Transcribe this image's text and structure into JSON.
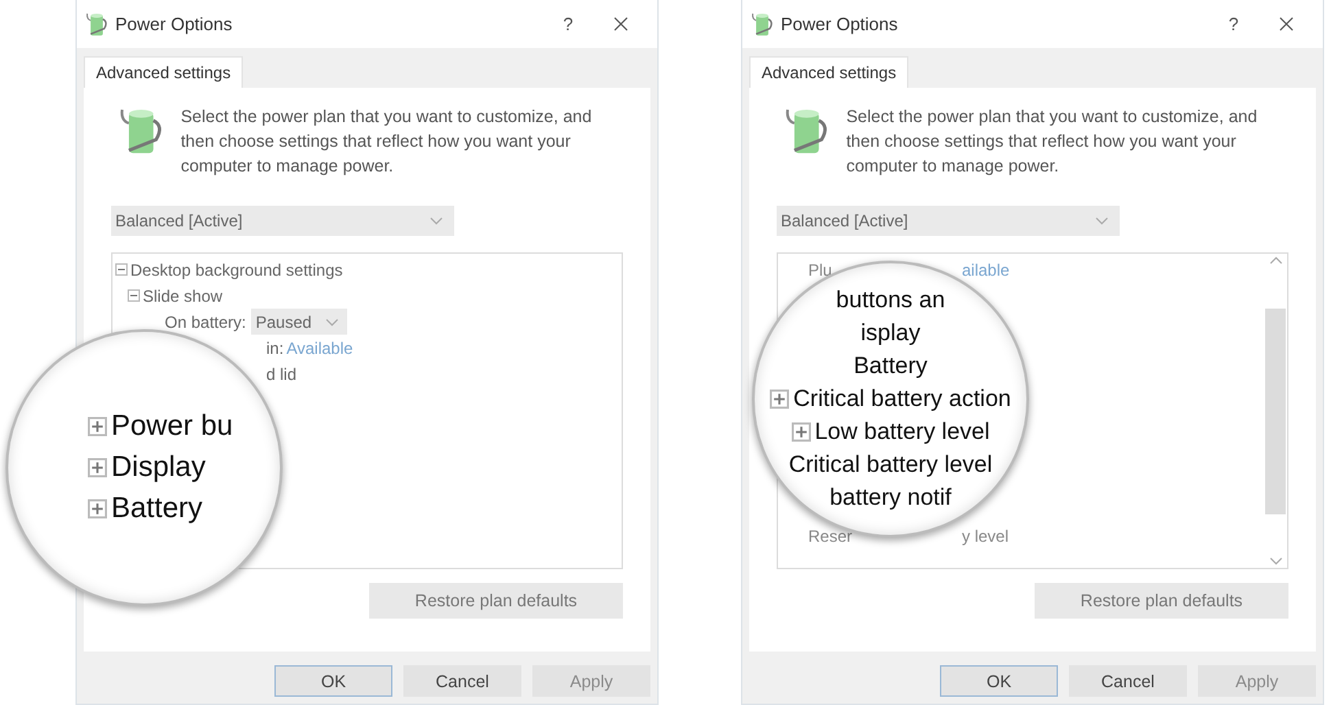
{
  "dialogs": [
    {
      "title": "Power Options",
      "help": "?",
      "tab": {
        "label": "Advanced settings",
        "selected": true
      },
      "description": "Select the power plan that you want to customize, and then choose settings that reflect how you want your computer to manage power.",
      "plan": "Balanced [Active]",
      "scrolled": false,
      "tree": [
        {
          "kind": "group",
          "label": "Desktop background settings",
          "expanded": true,
          "children": [
            {
              "kind": "group",
              "label": "Slide show",
              "expanded": true,
              "children": [
                {
                  "kind": "dropdown",
                  "label": "On battery:",
                  "value": "Paused"
                }
              ]
            }
          ]
        },
        {
          "kind": "fragment",
          "parts": [
            "in:",
            "Available"
          ]
        },
        {
          "kind": "fragment",
          "parts": [
            "d lid"
          ]
        }
      ],
      "magnifier": [
        {
          "label": "Power bu",
          "expander": true
        },
        {
          "label": "Display",
          "expander": true
        },
        {
          "label": "Battery",
          "expander": true
        }
      ],
      "restore": "Restore plan defaults",
      "buttons": [
        {
          "label": "OK",
          "disabled": false,
          "default": true
        },
        {
          "label": "Cancel",
          "disabled": false,
          "default": false
        },
        {
          "label": "Apply",
          "disabled": true,
          "default": false
        }
      ]
    },
    {
      "title": "Power Options",
      "help": "?",
      "tab": {
        "label": "Advanced settings",
        "selected": true
      },
      "description": "Select the power plan that you want to customize, and then choose settings that reflect how you want your computer to manage power.",
      "plan": "Balanced [Active]",
      "scrolled": true,
      "tree": [
        {
          "kind": "split",
          "parts": [
            {
              "text": "Plu",
              "link": false
            },
            {
              "text": "ailable",
              "link": true
            }
          ]
        },
        {
          "kind": "split",
          "parts": [
            {
              "text": "Reser",
              "link": false
            },
            {
              "text": "y level",
              "link": false
            }
          ]
        }
      ],
      "magnifier": [
        {
          "label": "buttons an",
          "expander": false
        },
        {
          "label": "isplay",
          "expander": false
        },
        {
          "label": "Battery",
          "expander": false
        },
        {
          "label": "Critical battery action",
          "expander": true
        },
        {
          "label": "Low battery level",
          "expander": true
        },
        {
          "label": "Critical battery level",
          "expander": false
        },
        {
          "label": "battery notif",
          "expander": false
        }
      ],
      "restore": "Restore plan defaults",
      "buttons": [
        {
          "label": "OK",
          "disabled": false,
          "default": true
        },
        {
          "label": "Cancel",
          "disabled": false,
          "default": false
        },
        {
          "label": "Apply",
          "disabled": true,
          "default": false
        }
      ]
    }
  ]
}
